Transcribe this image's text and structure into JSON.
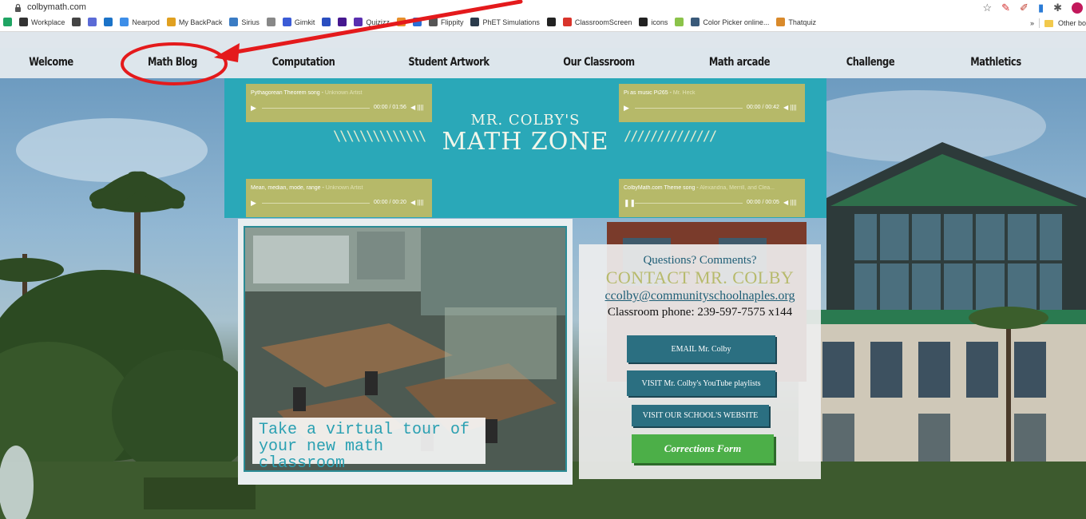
{
  "browser": {
    "url": "colbymath.com",
    "bookmarks": [
      {
        "label": "",
        "icon": "google-drive-icon",
        "color": "#1fa463"
      },
      {
        "label": "Workplace",
        "icon": "workplace-icon",
        "color": "#333333"
      },
      {
        "label": "",
        "icon": "dark-circle-icon",
        "color": "#444444"
      },
      {
        "label": "",
        "icon": "s-letter-icon",
        "color": "#5b6bd6"
      },
      {
        "label": "",
        "icon": "outlook-icon",
        "color": "#1b73c8"
      },
      {
        "label": "Nearpod",
        "icon": "nearpod-icon",
        "color": "#3d8ee8"
      },
      {
        "label": "My BackPack",
        "icon": "backpack-icon",
        "color": "#e0a020"
      },
      {
        "label": "Sirius",
        "icon": "sirius-icon",
        "color": "#3a7cc4"
      },
      {
        "label": "",
        "icon": "s-swirl-icon",
        "color": "#888888"
      },
      {
        "label": "Gimkit",
        "icon": "gimkit-icon",
        "color": "#3b5cd6"
      },
      {
        "label": "",
        "icon": "q-icon",
        "color": "#2a4ec0"
      },
      {
        "label": "",
        "icon": "kahoot-icon",
        "color": "#46178f"
      },
      {
        "label": "Quizizz",
        "icon": "quizizz-icon",
        "color": "#5a2fb0"
      },
      {
        "label": "",
        "icon": "colorful-icon",
        "color": "#e88e2a"
      },
      {
        "label": "",
        "icon": "building-icon",
        "color": "#2a6fd6"
      },
      {
        "label": "Flippity",
        "icon": "flippity-icon",
        "color": "#555555"
      },
      {
        "label": "PhET Simulations",
        "icon": "phet-icon",
        "color": "#2b3b4c"
      },
      {
        "label": "",
        "icon": "x-icon",
        "color": "#222222"
      },
      {
        "label": "ClassroomScreen",
        "icon": "classroomscreen-icon",
        "color": "#d9342b"
      },
      {
        "label": "icons",
        "icon": "dots-icon",
        "color": "#222222"
      },
      {
        "label": "",
        "icon": "plant-icon",
        "color": "#8bc34a"
      },
      {
        "label": "Color Picker online...",
        "icon": "color-picker-icon",
        "color": "#3a5a7a"
      },
      {
        "label": "Thatquiz",
        "icon": "thatquiz-icon",
        "color": "#d98a2b"
      }
    ],
    "overflow_label": "»",
    "other_bookmarks": "Other bo"
  },
  "nav": {
    "items": [
      {
        "label": "Welcome",
        "active": true
      },
      {
        "label": "Math Blog",
        "active": false
      },
      {
        "label": "Computation",
        "active": false
      },
      {
        "label": "Student Artwork",
        "active": false
      },
      {
        "label": "Our Classroom",
        "active": false
      },
      {
        "label": "Math arcade",
        "active": false
      },
      {
        "label": "Challenge",
        "active": false
      },
      {
        "label": "Mathletics",
        "active": false
      }
    ],
    "active_color": "#22b14c"
  },
  "header": {
    "line1": "MR. COLBY'S",
    "line2": "MATH ZONE",
    "left_hatch": "\\\\\\\\\\\\\\\\\\\\\\\\\\\\",
    "right_hatch": "//////////////",
    "bg_color": "#2aa8b8"
  },
  "players": [
    {
      "title": "Pythagorean Theorem song",
      "artist": "Unknown Artist",
      "time": "00:00 / 01:56",
      "state": "play"
    },
    {
      "title": "Pi as music Pi265",
      "artist": "Mr. Heck",
      "time": "00:00 / 00:42",
      "state": "play"
    },
    {
      "title": "Mean, median, mode, range",
      "artist": "Unknown Artist",
      "time": "00:00 / 00:20",
      "state": "play"
    },
    {
      "title": "ColbyMath.com Theme song",
      "artist": "Alexandria, Merrill, and Clea...",
      "time": "00:00 / 00:05",
      "state": "pause"
    }
  ],
  "tour": {
    "caption": "Take a virtual tour of your new math classroom"
  },
  "contact": {
    "question": "Questions? Comments?",
    "heading": "CONTACT MR. COLBY",
    "email": "ccolby@communityschoolnaples.org",
    "phone": "Classroom phone: 239-597-7575 x144",
    "buttons": [
      {
        "label": "EMAIL Mr. Colby"
      },
      {
        "label": "VISIT Mr. Colby's YouTube playlists"
      },
      {
        "label": "VISIT OUR SCHOOL'S WEBSITE"
      }
    ],
    "corrections_label": "Corrections Form"
  },
  "annotation_color": "#e41a1c"
}
